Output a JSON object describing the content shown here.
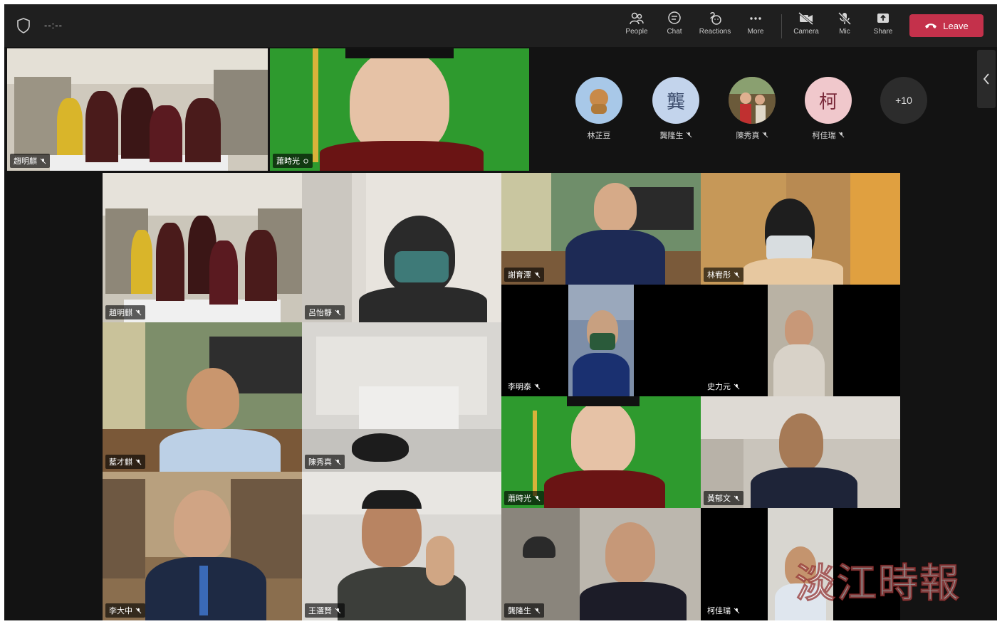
{
  "topbar": {
    "timer": "--:--",
    "buttons": [
      {
        "label": "People"
      },
      {
        "label": "Chat"
      },
      {
        "label": "Reactions"
      },
      {
        "label": "More"
      },
      {
        "label": "Camera"
      },
      {
        "label": "Mic"
      },
      {
        "label": "Share"
      }
    ],
    "leave_label": "Leave"
  },
  "top_row": {
    "tiles": [
      {
        "name": "趙明麒"
      },
      {
        "name": "蕭時光"
      }
    ],
    "avatars": [
      {
        "name": "林芷豆",
        "initial": ""
      },
      {
        "name": "龔隆生",
        "initial": "龔"
      },
      {
        "name": "陳秀真",
        "initial": ""
      },
      {
        "name": "柯佳瑞",
        "initial": "柯"
      }
    ],
    "overflow": "+10"
  },
  "grid": {
    "tiles": [
      {
        "name": "趙明麒"
      },
      {
        "name": "呂怡靜"
      },
      {
        "name": "謝育澤"
      },
      {
        "name": "林宥彤"
      },
      {
        "name": "李明泰"
      },
      {
        "name": "史力元"
      },
      {
        "name": "藍才麒"
      },
      {
        "name": "陳秀真"
      },
      {
        "name": "蕭時光"
      },
      {
        "name": "黃郁文"
      },
      {
        "name": "李大中"
      },
      {
        "name": "王選賢"
      },
      {
        "name": "龔隆生"
      },
      {
        "name": "柯佳瑞"
      }
    ]
  },
  "watermark": "淡江時報",
  "colors": {
    "topbar": "#1f1f1f",
    "stage": "#131313",
    "leave": "#c4314b",
    "greenscreen": "#2e9a2e"
  }
}
